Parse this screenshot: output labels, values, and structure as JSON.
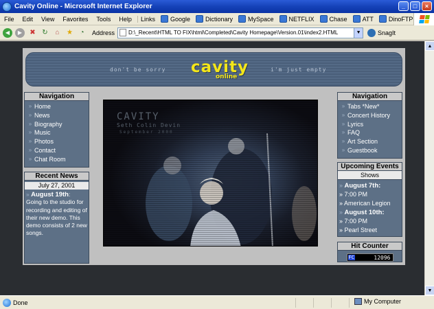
{
  "window": {
    "title": "Cavity Online - Microsoft Internet Explorer",
    "buttons": {
      "minimize": "_",
      "maximize": "□",
      "close": "×"
    }
  },
  "menu": [
    "File",
    "Edit",
    "View",
    "Favorites",
    "Tools",
    "Help"
  ],
  "links": {
    "label": "Links",
    "items": [
      "Google",
      "Dictionary",
      "MySpace",
      "NETFLIX",
      "Chase",
      "ATT",
      "DinoFTP"
    ]
  },
  "address": {
    "label": "Address",
    "value": "D:\\_Recent\\HTML TO FIX\\html\\Completed\\Cavity Homepage\\Version.01\\index2.HTML",
    "snagit": "SnagIt"
  },
  "site": {
    "banner": {
      "left_tag": "don't be sorry",
      "right_tag": "i'm just empty",
      "logo_word": "cavity",
      "logo_sub": "online"
    },
    "left_nav": {
      "heading": "Navigation",
      "items": [
        "Home",
        "News",
        "Biography",
        "Music",
        "Photos",
        "Contact",
        "Chat Room"
      ]
    },
    "recent_news": {
      "heading": "Recent News",
      "date": "July 27, 2001",
      "entry_title": "August 19th",
      "entry_text": "Going to the studio for recording and editing of their new demo. This demo consists of 2 new songs."
    },
    "photo": {
      "caption_title": "CAVITY",
      "caption_name": "Seth Colin Devin",
      "caption_date": "September 2000"
    },
    "right_nav": {
      "heading": "Navigation",
      "items": [
        "Tabs *New*",
        "Concert History",
        "Lyrics",
        "FAQ",
        "Art Section",
        "Guestbook"
      ]
    },
    "events": {
      "heading": "Upcoming Events",
      "subheading": "Shows",
      "items": [
        {
          "date": "August 7th:",
          "time": "7:00 PM",
          "place": "American Legion"
        },
        {
          "date": "August 10th:",
          "time": "7:00 PM",
          "place": "Pearl Street"
        }
      ]
    },
    "counter": {
      "heading": "Hit Counter",
      "badge": "FC",
      "value": "12096"
    }
  },
  "status": {
    "text": "Done",
    "zone": "My Computer"
  },
  "colors": {
    "logo_yellow": "#f4e619",
    "panel_blue": "#5d7086",
    "title_blue": "#1542b8"
  }
}
